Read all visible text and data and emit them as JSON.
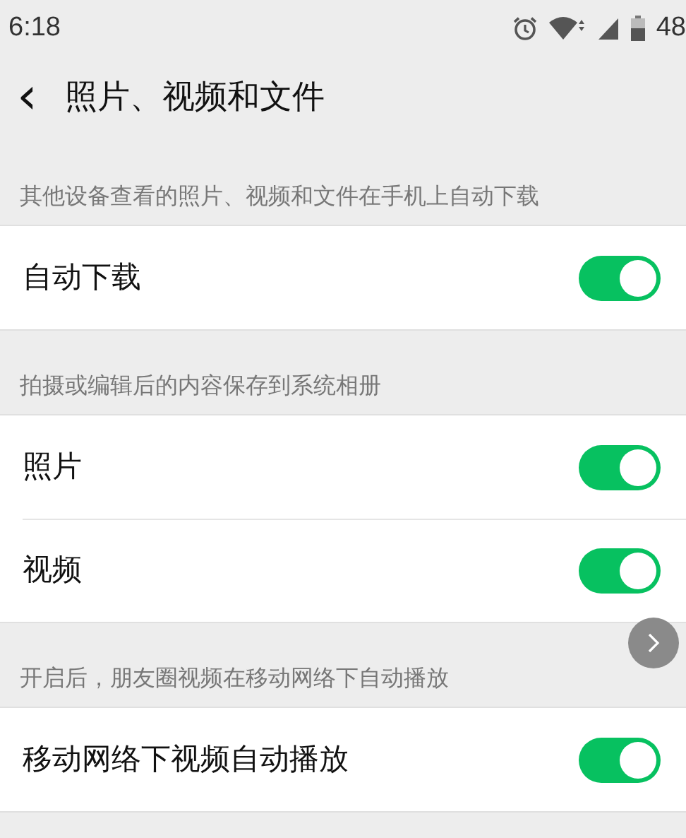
{
  "status_bar": {
    "time": "6:18",
    "battery": "48"
  },
  "header": {
    "back": "‹",
    "title": "照片、视频和文件"
  },
  "sections": [
    {
      "note": "其他设备查看的照片、视频和文件在手机上自动下载",
      "rows": [
        {
          "label": "自动下载",
          "on": true
        }
      ]
    },
    {
      "note": "拍摄或编辑后的内容保存到系统相册",
      "rows": [
        {
          "label": "照片",
          "on": true
        },
        {
          "label": "视频",
          "on": true
        }
      ]
    },
    {
      "note": "开启后，朋友圈视频在移动网络下自动播放",
      "rows": [
        {
          "label": "移动网络下视频自动播放",
          "on": true
        }
      ]
    }
  ]
}
